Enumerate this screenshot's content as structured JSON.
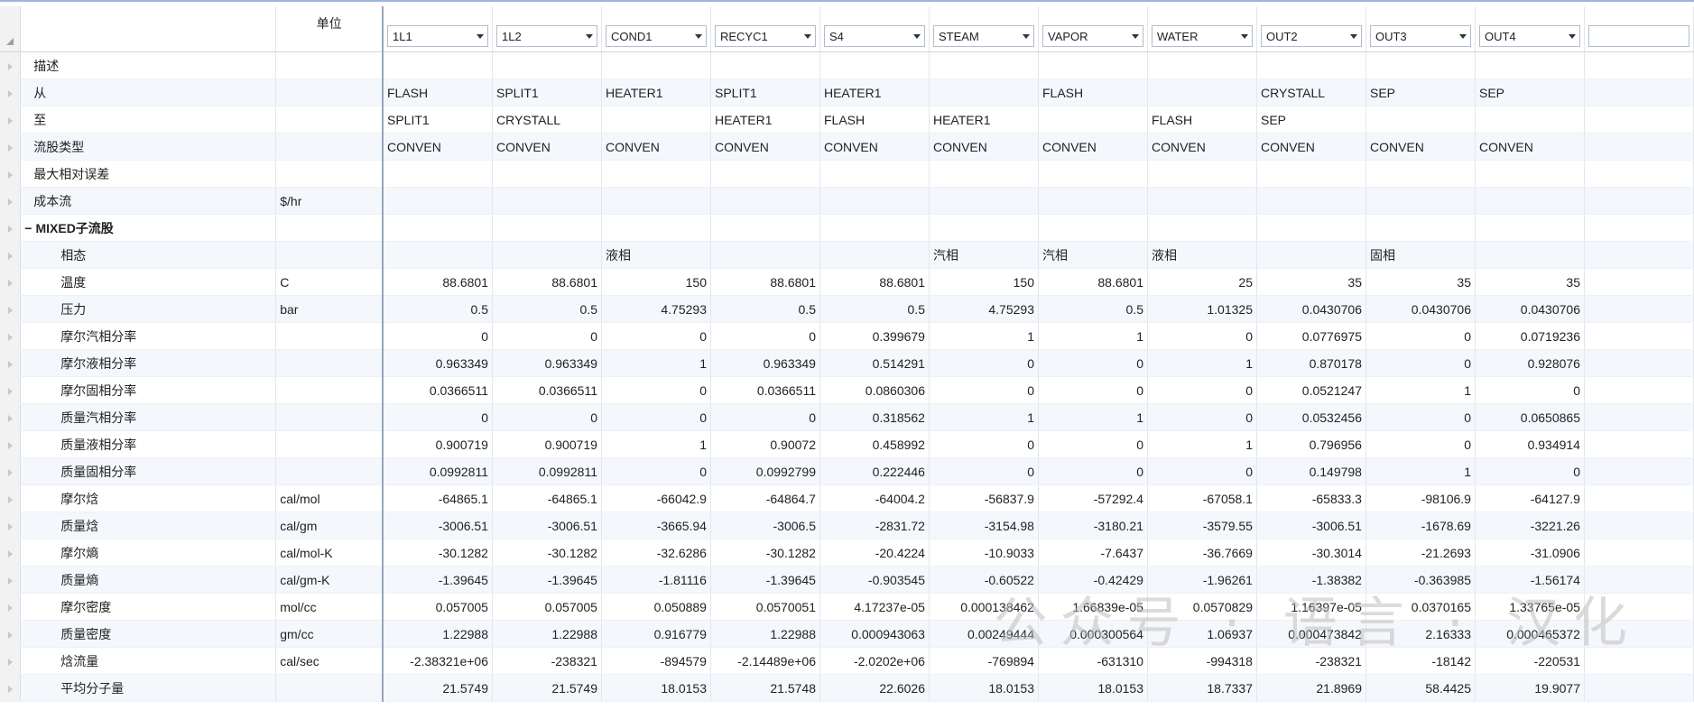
{
  "header": {
    "unit_label": "单位",
    "streams": [
      "1L1",
      "1L2",
      "COND1",
      "RECYC1",
      "S4",
      "STEAM",
      "VAPOR",
      "WATER",
      "OUT2",
      "OUT3",
      "OUT4",
      ""
    ]
  },
  "rows": [
    {
      "name": "描述",
      "unit": "",
      "kind": "text",
      "level": 1,
      "values": [
        "",
        "",
        "",
        "",
        "",
        "",
        "",
        "",
        "",
        "",
        ""
      ]
    },
    {
      "name": "从",
      "unit": "",
      "kind": "text",
      "level": 1,
      "values": [
        "FLASH",
        "SPLIT1",
        "HEATER1",
        "SPLIT1",
        "HEATER1",
        "",
        "FLASH",
        "",
        "CRYSTALL",
        "SEP",
        "SEP"
      ]
    },
    {
      "name": "至",
      "unit": "",
      "kind": "text",
      "level": 1,
      "values": [
        "SPLIT1",
        "CRYSTALL",
        "",
        "HEATER1",
        "FLASH",
        "HEATER1",
        "",
        "FLASH",
        "SEP",
        "",
        ""
      ]
    },
    {
      "name": "流股类型",
      "unit": "",
      "kind": "text",
      "level": 1,
      "values": [
        "CONVEN",
        "CONVEN",
        "CONVEN",
        "CONVEN",
        "CONVEN",
        "CONVEN",
        "CONVEN",
        "CONVEN",
        "CONVEN",
        "CONVEN",
        "CONVEN"
      ]
    },
    {
      "name": "最大相对误差",
      "unit": "",
      "kind": "text",
      "level": 1,
      "values": [
        "",
        "",
        "",
        "",
        "",
        "",
        "",
        "",
        "",
        "",
        ""
      ]
    },
    {
      "name": "成本流",
      "unit": "$/hr",
      "kind": "text",
      "level": 1,
      "values": [
        "",
        "",
        "",
        "",
        "",
        "",
        "",
        "",
        "",
        "",
        ""
      ]
    },
    {
      "name": "MIXED子流股",
      "unit": "",
      "kind": "group",
      "level": 0,
      "collapse": "−",
      "values": [
        "",
        "",
        "",
        "",
        "",
        "",
        "",
        "",
        "",
        "",
        ""
      ]
    },
    {
      "name": "相态",
      "unit": "",
      "kind": "text",
      "level": 2,
      "values": [
        "",
        "",
        "液相",
        "",
        "",
        "汽相",
        "汽相",
        "液相",
        "",
        "固相",
        ""
      ]
    },
    {
      "name": "温度",
      "unit": "C",
      "kind": "num",
      "level": 2,
      "values": [
        "88.6801",
        "88.6801",
        "150",
        "88.6801",
        "88.6801",
        "150",
        "88.6801",
        "25",
        "35",
        "35",
        "35"
      ]
    },
    {
      "name": "压力",
      "unit": "bar",
      "kind": "num",
      "level": 2,
      "values": [
        "0.5",
        "0.5",
        "4.75293",
        "0.5",
        "0.5",
        "4.75293",
        "0.5",
        "1.01325",
        "0.0430706",
        "0.0430706",
        "0.0430706"
      ]
    },
    {
      "name": "摩尔汽相分率",
      "unit": "",
      "kind": "num",
      "level": 2,
      "values": [
        "0",
        "0",
        "0",
        "0",
        "0.399679",
        "1",
        "1",
        "0",
        "0.0776975",
        "0",
        "0.0719236"
      ]
    },
    {
      "name": "摩尔液相分率",
      "unit": "",
      "kind": "num",
      "level": 2,
      "values": [
        "0.963349",
        "0.963349",
        "1",
        "0.963349",
        "0.514291",
        "0",
        "0",
        "1",
        "0.870178",
        "0",
        "0.928076"
      ]
    },
    {
      "name": "摩尔固相分率",
      "unit": "",
      "kind": "num",
      "level": 2,
      "values": [
        "0.0366511",
        "0.0366511",
        "0",
        "0.0366511",
        "0.0860306",
        "0",
        "0",
        "0",
        "0.0521247",
        "1",
        "0"
      ]
    },
    {
      "name": "质量汽相分率",
      "unit": "",
      "kind": "num",
      "level": 2,
      "values": [
        "0",
        "0",
        "0",
        "0",
        "0.318562",
        "1",
        "1",
        "0",
        "0.0532456",
        "0",
        "0.0650865"
      ]
    },
    {
      "name": "质量液相分率",
      "unit": "",
      "kind": "num",
      "level": 2,
      "values": [
        "0.900719",
        "0.900719",
        "1",
        "0.90072",
        "0.458992",
        "0",
        "0",
        "1",
        "0.796956",
        "0",
        "0.934914"
      ]
    },
    {
      "name": "质量固相分率",
      "unit": "",
      "kind": "num",
      "level": 2,
      "values": [
        "0.0992811",
        "0.0992811",
        "0",
        "0.0992799",
        "0.222446",
        "0",
        "0",
        "0",
        "0.149798",
        "1",
        "0"
      ]
    },
    {
      "name": "摩尔焓",
      "unit": "cal/mol",
      "kind": "num",
      "level": 2,
      "values": [
        "-64865.1",
        "-64865.1",
        "-66042.9",
        "-64864.7",
        "-64004.2",
        "-56837.9",
        "-57292.4",
        "-67058.1",
        "-65833.3",
        "-98106.9",
        "-64127.9"
      ]
    },
    {
      "name": "质量焓",
      "unit": "cal/gm",
      "kind": "num",
      "level": 2,
      "values": [
        "-3006.51",
        "-3006.51",
        "-3665.94",
        "-3006.5",
        "-2831.72",
        "-3154.98",
        "-3180.21",
        "-3579.55",
        "-3006.51",
        "-1678.69",
        "-3221.26"
      ]
    },
    {
      "name": "摩尔熵",
      "unit": "cal/mol-K",
      "kind": "num",
      "level": 2,
      "values": [
        "-30.1282",
        "-30.1282",
        "-32.6286",
        "-30.1282",
        "-20.4224",
        "-10.9033",
        "-7.6437",
        "-36.7669",
        "-30.3014",
        "-21.2693",
        "-31.0906"
      ]
    },
    {
      "name": "质量熵",
      "unit": "cal/gm-K",
      "kind": "num",
      "level": 2,
      "values": [
        "-1.39645",
        "-1.39645",
        "-1.81116",
        "-1.39645",
        "-0.903545",
        "-0.60522",
        "-0.42429",
        "-1.96261",
        "-1.38382",
        "-0.363985",
        "-1.56174"
      ]
    },
    {
      "name": "摩尔密度",
      "unit": "mol/cc",
      "kind": "num",
      "level": 2,
      "values": [
        "0.057005",
        "0.057005",
        "0.050889",
        "0.0570051",
        "4.17237e-05",
        "0.000138462",
        "1.66839e-05",
        "0.0570829",
        "1.16397e-05",
        "0.0370165",
        "1.33765e-05"
      ]
    },
    {
      "name": "质量密度",
      "unit": "gm/cc",
      "kind": "num",
      "level": 2,
      "values": [
        "1.22988",
        "1.22988",
        "0.916779",
        "1.22988",
        "0.000943063",
        "0.00249444",
        "0.000300564",
        "1.06937",
        "0.000473842",
        "2.16333",
        "0.000465372"
      ]
    },
    {
      "name": "焓流量",
      "unit": "cal/sec",
      "kind": "num",
      "level": 2,
      "values": [
        "-2.38321e+06",
        "-238321",
        "-894579",
        "-2.14489e+06",
        "-2.0202e+06",
        "-769894",
        "-631310",
        "-994318",
        "-238321",
        "-18142",
        "-220531"
      ]
    },
    {
      "name": "平均分子量",
      "unit": "",
      "kind": "num",
      "level": 2,
      "values": [
        "21.5749",
        "21.5749",
        "18.0153",
        "21.5748",
        "22.6026",
        "18.0153",
        "18.0153",
        "18.7337",
        "21.8969",
        "58.4425",
        "19.9077"
      ]
    }
  ],
  "watermark": "公众号 · 语言 · 汉化"
}
